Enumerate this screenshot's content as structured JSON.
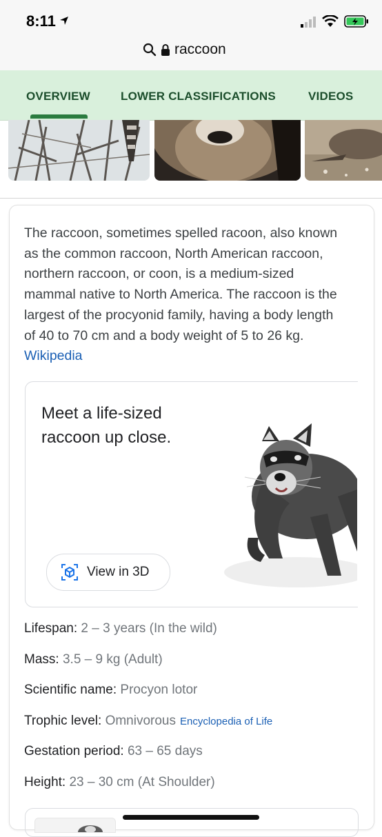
{
  "status_bar": {
    "time": "8:11"
  },
  "address_bar": {
    "query": "raccoon"
  },
  "tabs": [
    {
      "label": "OVERVIEW",
      "active": true
    },
    {
      "label": "LOWER CLASSIFICATIONS",
      "active": false
    },
    {
      "label": "VIDEOS",
      "active": false
    }
  ],
  "description": {
    "text": "The raccoon, sometimes spelled racoon, also known as the common raccoon, North American raccoon, northern raccoon, or coon, is a medium-sized mammal native to North America. The raccoon is the largest of the procyonid family, having a body length of 40 to 70 cm and a body weight of 5 to 26 kg.",
    "source": "Wikipedia"
  },
  "ar_card": {
    "title": "Meet a life-sized raccoon up close.",
    "button_label": "View in 3D"
  },
  "facts": [
    {
      "label": "Lifespan:",
      "value": "2 – 3 years (In the wild)"
    },
    {
      "label": "Mass:",
      "value": "3.5 – 9 kg (Adult)"
    },
    {
      "label": "Scientific name:",
      "value": "Procyon lotor"
    },
    {
      "label": "Trophic level:",
      "value": "Omnivorous",
      "source": "Encyclopedia of Life"
    },
    {
      "label": "Gestation period:",
      "value": "63 – 65 days"
    },
    {
      "label": "Height:",
      "value": "23 – 30 cm (At Shoulder)"
    }
  ],
  "colors": {
    "tab_bg": "#d9f0dc",
    "tab_text": "#1b4d2b",
    "tab_indicator": "#2a7b3f",
    "link": "#1a5fb4",
    "battery": "#34c759"
  }
}
